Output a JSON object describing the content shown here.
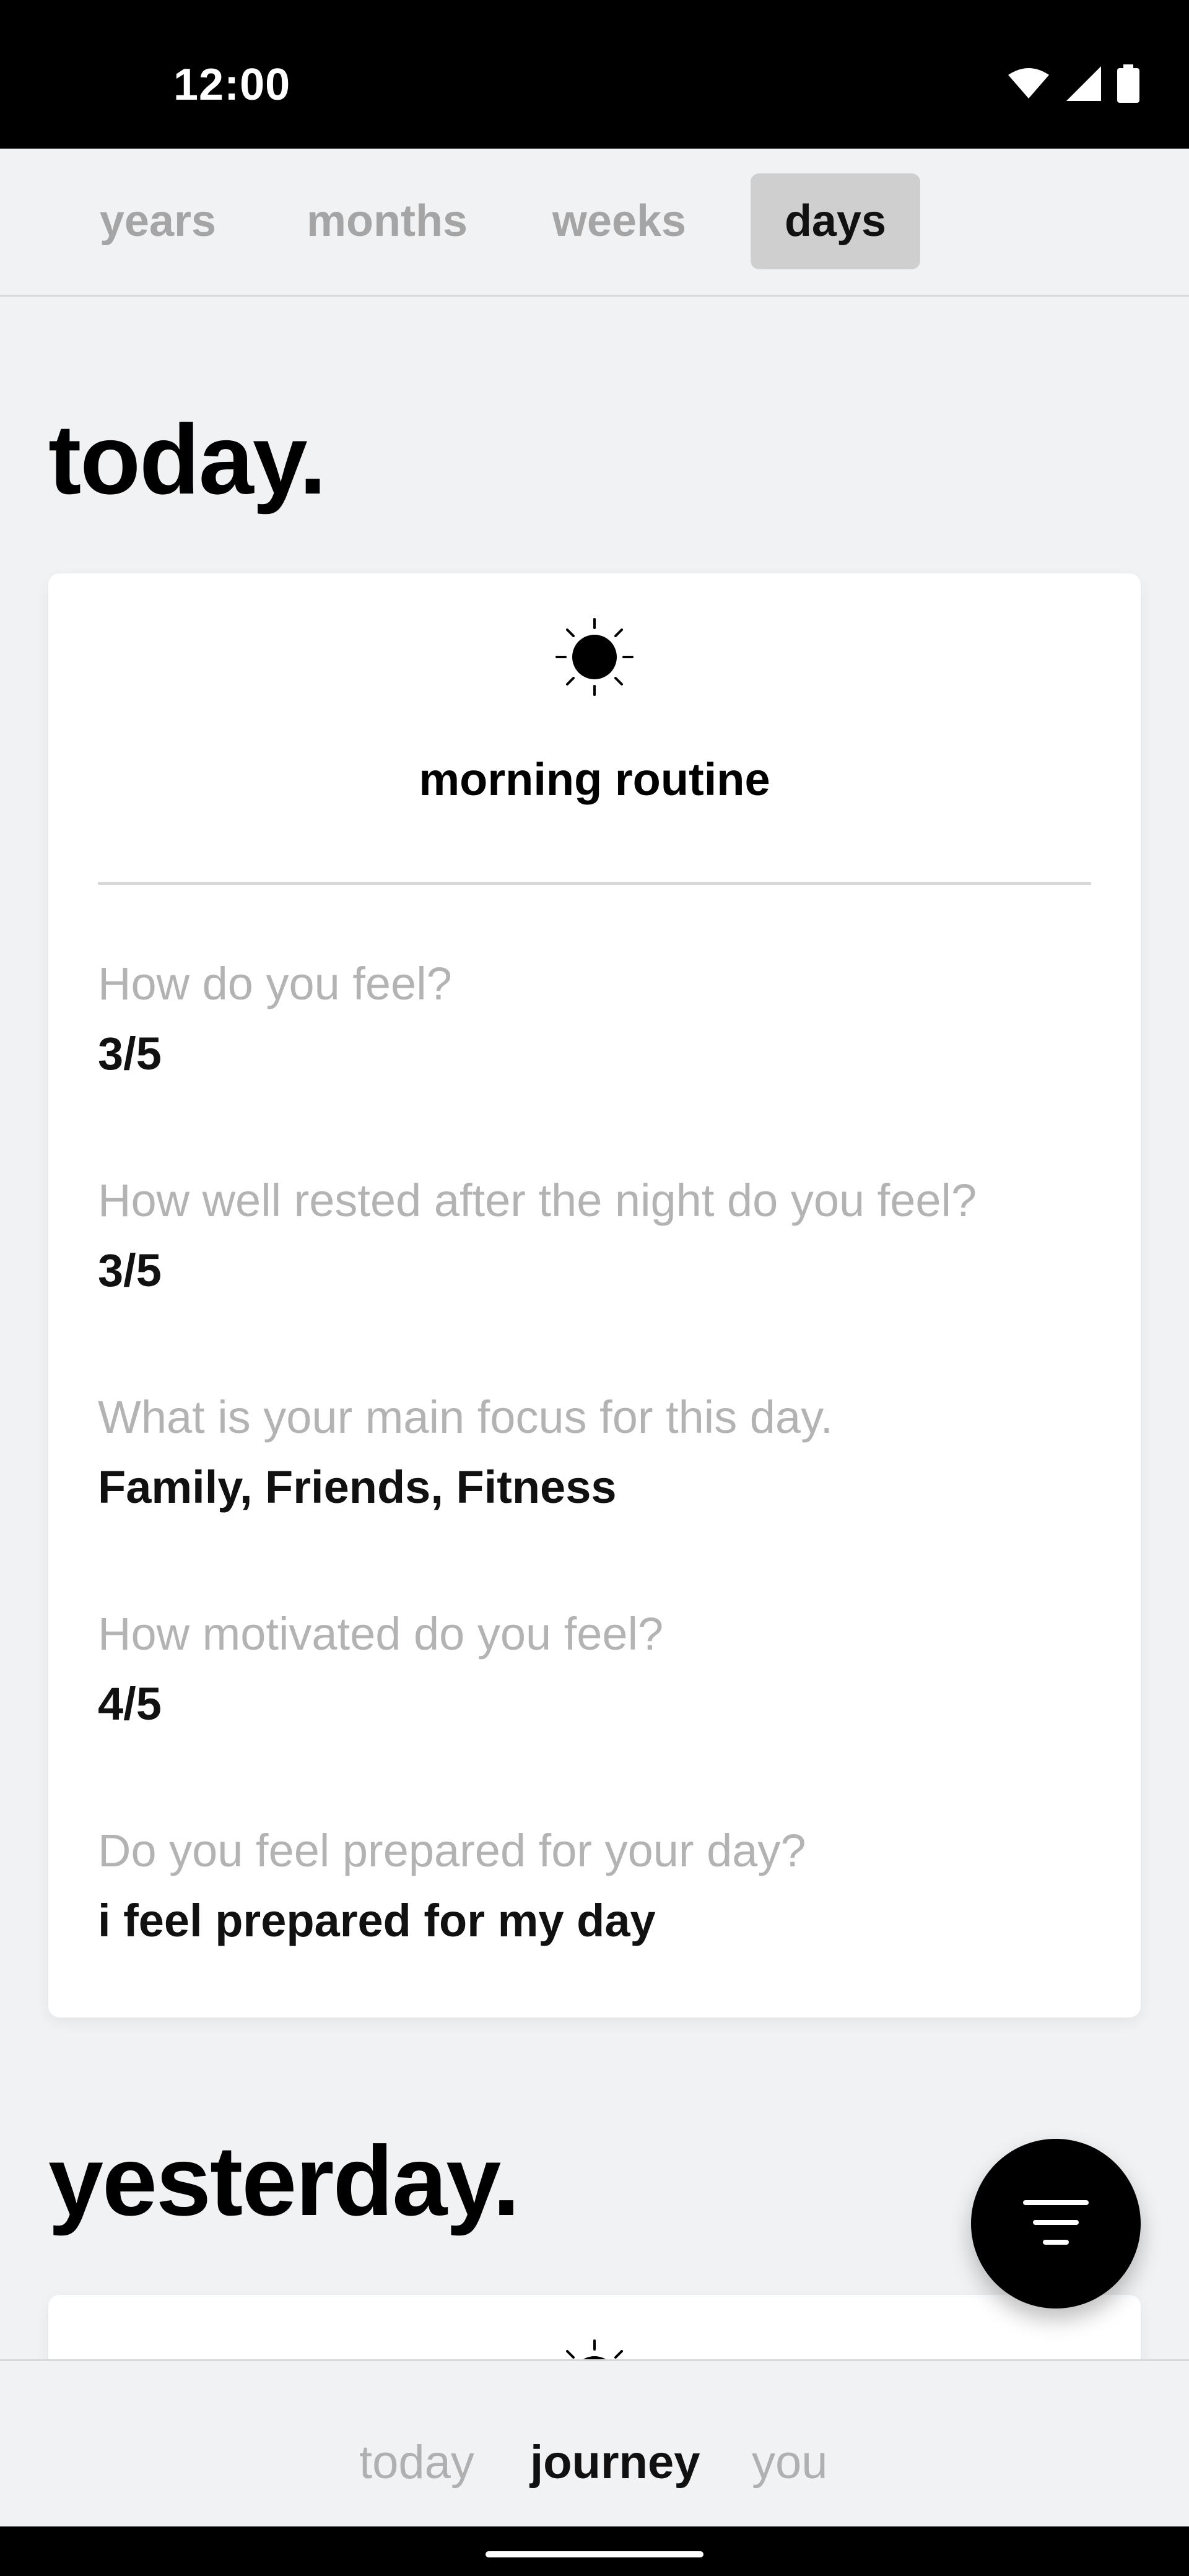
{
  "status_bar": {
    "time": "12:00"
  },
  "tabs": [
    {
      "label": "years",
      "active": false
    },
    {
      "label": "months",
      "active": false
    },
    {
      "label": "weeks",
      "active": false
    },
    {
      "label": "days",
      "active": true
    }
  ],
  "sections": {
    "today": {
      "title": "today.",
      "card": {
        "icon": "sun-icon",
        "title": "morning routine",
        "items": [
          {
            "question": "How do you feel?",
            "answer": "3/5"
          },
          {
            "question": "How well rested after the night do you feel?",
            "answer": "3/5"
          },
          {
            "question": "What is your main focus for this day.",
            "answer": "Family, Friends, Fitness"
          },
          {
            "question": "How motivated do you feel?",
            "answer": "4/5"
          },
          {
            "question": "Do you feel prepared for your day?",
            "answer": "i feel prepared for my day"
          }
        ]
      }
    },
    "yesterday": {
      "title": "yesterday.",
      "card": {
        "icon": "sun-icon"
      }
    }
  },
  "fab": {
    "icon": "filter-icon"
  },
  "bottom_nav": [
    {
      "label": "today",
      "active": false
    },
    {
      "label": "journey",
      "active": true
    },
    {
      "label": "you",
      "active": false
    }
  ]
}
